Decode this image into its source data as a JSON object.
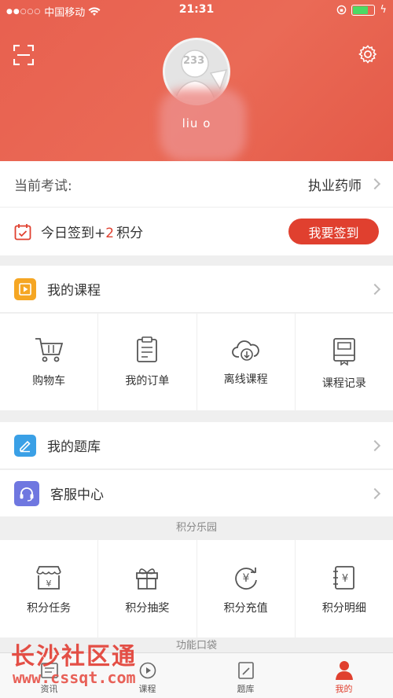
{
  "status_bar": {
    "carrier": "中国移动",
    "time": "21:31"
  },
  "profile": {
    "username": "liu          o",
    "avatar_text": "233"
  },
  "current_exam": {
    "label": "当前考试:",
    "value": "执业药师"
  },
  "checkin": {
    "text_prefix": "今日签到+",
    "points": "2",
    "text_suffix": "积分",
    "button": "我要签到"
  },
  "my_courses": {
    "label": "我的课程"
  },
  "course_grid": [
    {
      "label": "购物车",
      "icon": "cart-icon"
    },
    {
      "label": "我的订单",
      "icon": "order-icon"
    },
    {
      "label": "离线课程",
      "icon": "cloud-download-icon"
    },
    {
      "label": "课程记录",
      "icon": "record-icon"
    }
  ],
  "my_question_bank": {
    "label": "我的题库"
  },
  "customer_service": {
    "label": "客服中心"
  },
  "points_park": {
    "title": "积分乐园"
  },
  "points_grid": [
    {
      "label": "积分任务",
      "icon": "shop-icon"
    },
    {
      "label": "积分抽奖",
      "icon": "gift-icon"
    },
    {
      "label": "积分充值",
      "icon": "yuan-refresh-icon"
    },
    {
      "label": "积分明细",
      "icon": "ledger-icon"
    }
  ],
  "function_section": {
    "title": "功能口袋"
  },
  "tab_bar": [
    {
      "label": "资讯",
      "icon": "news-icon"
    },
    {
      "label": "课程",
      "icon": "course-icon"
    },
    {
      "label": "题库",
      "icon": "question-bank-icon"
    },
    {
      "label": "我的",
      "icon": "me-icon",
      "active": true
    }
  ],
  "watermark": {
    "line1": "长沙社区通",
    "line2": "www.cssqt.com"
  },
  "colors": {
    "accent": "#e0402f",
    "header": "#e8604f"
  }
}
